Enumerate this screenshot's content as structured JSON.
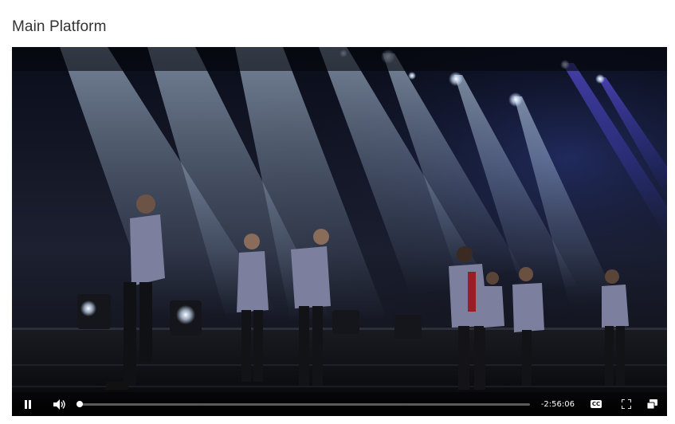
{
  "page": {
    "title": "Main Platform"
  },
  "player": {
    "state": "playing",
    "remaining_time": "-2:56:06",
    "progress_fraction": 0.0,
    "controls": {
      "play_pause_icon": "pause-icon",
      "volume_icon": "volume-icon",
      "cc_label": "CC",
      "fullscreen_icon": "fullscreen-icon",
      "pip_icon": "picture-in-picture-icon"
    },
    "colors": {
      "background": "#05070d",
      "controls_fg": "#ffffff"
    }
  }
}
